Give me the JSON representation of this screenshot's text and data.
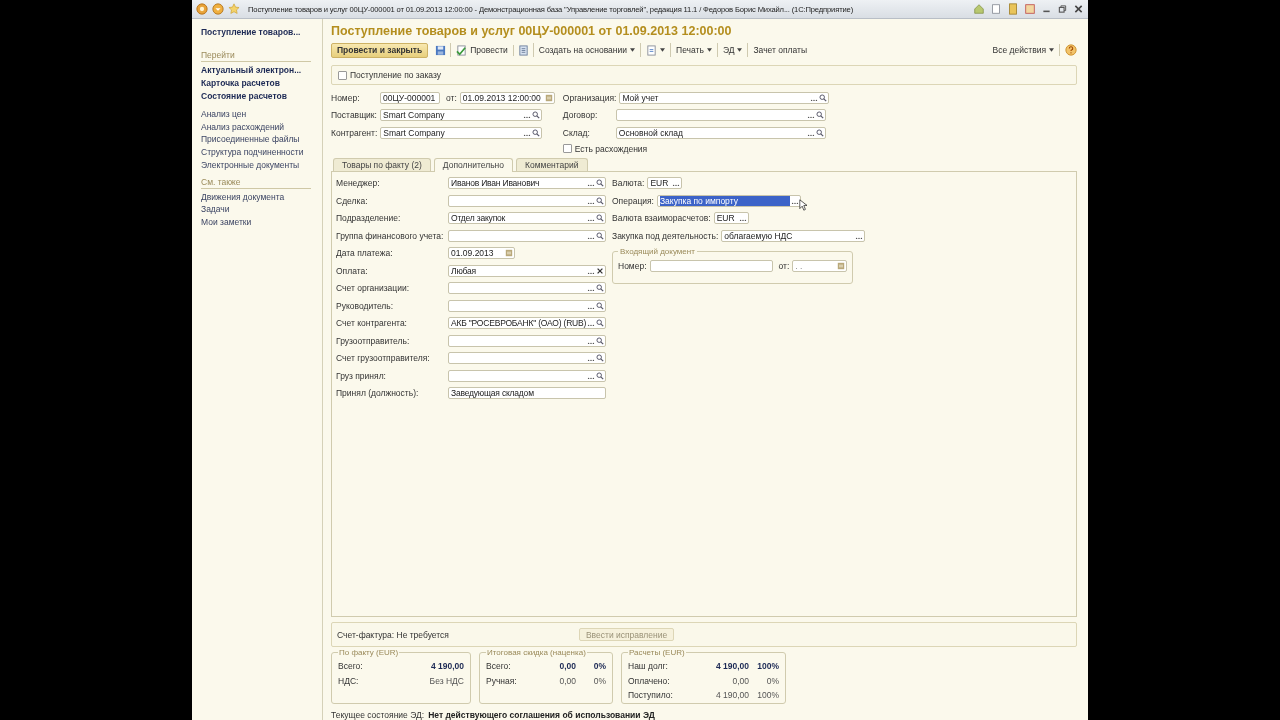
{
  "title_bar": {
    "title": "Поступление товаров и услуг 00ЦУ-000001 от 01.09.2013 12:00:00 - Демонстрационная база \"Управление торговлей\", редакция 11.1 / Федоров Борис Михайл... (1С:Предприятие)"
  },
  "sidebar": {
    "current": "Поступление товаров...",
    "sections": [
      {
        "heading": "Перейти",
        "items": [
          {
            "label": "Актуальный электрон...",
            "kind": "main"
          },
          {
            "label": "Карточка расчетов",
            "kind": "main"
          },
          {
            "label": "Состояние расчетов",
            "kind": "main"
          },
          {
            "label": "Анализ цен",
            "kind": "extra"
          },
          {
            "label": "Анализ расхождений",
            "kind": "extra"
          },
          {
            "label": "Присоединенные файлы",
            "kind": "extra"
          },
          {
            "label": "Структура подчиненности",
            "kind": "extra"
          },
          {
            "label": "Электронные документы",
            "kind": "extra"
          }
        ]
      },
      {
        "heading": "См. также",
        "items": [
          {
            "label": "Движения документа",
            "kind": "extra"
          },
          {
            "label": "Задачи",
            "kind": "extra"
          },
          {
            "label": "Мои заметки",
            "kind": "extra"
          }
        ]
      }
    ]
  },
  "form": {
    "title": "Поступление товаров и услуг 00ЦУ-000001 от 01.09.2013 12:00:00",
    "toolbar": [
      {
        "kind": "primary",
        "label": "Провести и закрыть"
      },
      {
        "kind": "save"
      },
      {
        "kind": "post",
        "label": "Провести"
      },
      {
        "kind": "list"
      },
      {
        "kind": "menu",
        "label": "Создать на основании"
      },
      {
        "kind": "doc-menu"
      },
      {
        "kind": "menu",
        "label": "Печать"
      },
      {
        "kind": "menu",
        "label": "ЭД"
      },
      {
        "kind": "button",
        "label": "Зачет оплаты"
      }
    ],
    "toolbar_right": [
      {
        "kind": "menu",
        "label": "Все действия"
      },
      {
        "kind": "help"
      }
    ],
    "by_order": {
      "label": "Поступление по заказу",
      "checked": false
    },
    "header": {
      "number": {
        "label": "Номер:",
        "value": "00ЦУ-000001"
      },
      "date": {
        "label": "от:",
        "value": "01.09.2013 12:00:00"
      },
      "left": [
        {
          "label": "Поставщик:",
          "value": "Smart Company",
          "kind": "ref"
        },
        {
          "label": "Контрагент:",
          "value": "Smart Company",
          "kind": "ref"
        }
      ],
      "right": [
        {
          "label": "Организация:",
          "value": "Мой учет",
          "kind": "ref"
        },
        {
          "label": "Договор:",
          "kind": "ref"
        },
        {
          "label": "Склад:",
          "value": "Основной склад",
          "kind": "ref"
        }
      ]
    },
    "discrepancies": {
      "label": "Есть расхождения",
      "checked": false
    },
    "tabs": [
      {
        "label": "Товары по факту (2)",
        "selected": false
      },
      {
        "label": "Дополнительно",
        "selected": true
      },
      {
        "label": "Комментарий",
        "selected": false
      }
    ],
    "details": {
      "left": [
        {
          "label": "Менеджер:",
          "value": "Иванов Иван Иванович",
          "kind": "ref"
        },
        {
          "label": "Сделка:",
          "kind": "ref"
        },
        {
          "label": "Подразделение:",
          "value": "Отдел закупок",
          "kind": "ref"
        },
        {
          "label": "Группа финансового учета:",
          "kind": "ref"
        },
        {
          "label": "Дата платежа:",
          "value": "01.09.2013",
          "kind": "date"
        },
        {
          "label": "Оплата:",
          "value": "Любая",
          "kind": "clear"
        },
        {
          "label": "Счет организации:",
          "kind": "ref"
        },
        {
          "label": "Руководитель:",
          "kind": "ref"
        },
        {
          "label": "Счет контрагента:",
          "value": "АКБ \"РОСЕВРОБАНК\" (ОАО) (RUB)",
          "kind": "ref"
        },
        {
          "label": "Грузоотправитель:",
          "kind": "ref"
        },
        {
          "label": "Счет грузоотправителя:",
          "kind": "ref"
        },
        {
          "label": "Груз принял:",
          "kind": "ref"
        },
        {
          "label": "Принял (должность):",
          "value": "Заведующая складом",
          "kind": "text"
        }
      ],
      "right": [
        {
          "label": "Валюта:",
          "value": "EUR",
          "kind": "currency",
          "selected": false
        },
        {
          "label": "Операция:",
          "value": "Закупка по импорту",
          "kind": "choice",
          "selected": true
        },
        {
          "label": "Валюта взаиморасчетов:",
          "value": "EUR",
          "kind": "currency",
          "selected": false
        },
        {
          "label": "Закупка под деятельность:",
          "value": "облагаемую НДС",
          "kind": "choice",
          "selected": false
        }
      ],
      "incoming_document": {
        "title": "Входящий документ",
        "number": {
          "label": "Номер:"
        },
        "date": {
          "label": "от:",
          "placeholder": " .  ."
        }
      }
    },
    "invoice": {
      "label": "Счет-фактура: Не требуется",
      "button": {
        "label": "Ввести исправление",
        "disabled": true
      }
    },
    "totals": [
      {
        "title": "По факту (EUR)",
        "rows": [
          {
            "label": "Всего:",
            "value": "4 190,00",
            "emphasis": true
          },
          {
            "label": "НДС:",
            "value": "Без НДС",
            "emphasis": false
          }
        ]
      },
      {
        "title": "Итоговая скидка (наценка)",
        "rows": [
          {
            "label": "Всего:",
            "value": "0,00",
            "percent": "0%",
            "emphasis": true
          },
          {
            "label": "Ручная:",
            "value": "0,00",
            "percent": "0%",
            "emphasis": false
          }
        ]
      },
      {
        "title": "Расчеты (EUR)",
        "rows": [
          {
            "label": "Наш долг:",
            "value": "4 190,00",
            "percent": "100%",
            "emphasis": true
          },
          {
            "label": "Оплачено:",
            "value": "0,00",
            "percent": "0%",
            "emphasis": false
          },
          {
            "label": "Поступило:",
            "value": "4 190,00",
            "percent": "100%",
            "emphasis": false
          }
        ]
      }
    ],
    "status": {
      "label": "Текущее состояние ЭД:",
      "value": "Нет действующего соглашения об использовании ЭД"
    }
  }
}
